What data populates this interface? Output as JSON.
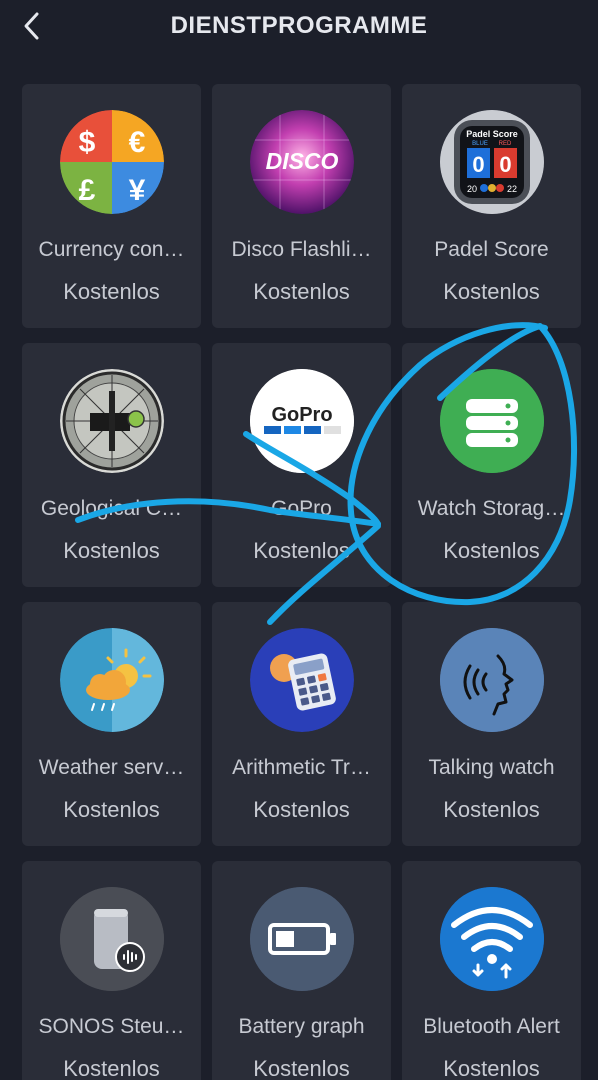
{
  "header": {
    "title": "DIENSTPROGRAMME",
    "back_icon": "chevron-left-icon"
  },
  "apps": [
    {
      "name": "Currency con…",
      "price": "Kostenlos",
      "icon": "currency-icon"
    },
    {
      "name": "Disco Flashli…",
      "price": "Kostenlos",
      "icon": "disco-icon"
    },
    {
      "name": "Padel Score",
      "price": "Kostenlos",
      "icon": "padel-score-icon"
    },
    {
      "name": "Geological C…",
      "price": "Kostenlos",
      "icon": "compass-icon"
    },
    {
      "name": "GoPro",
      "price": "Kostenlos",
      "icon": "gopro-icon"
    },
    {
      "name": "Watch Storag…",
      "price": "Kostenlos",
      "icon": "database-icon"
    },
    {
      "name": "Weather serv…",
      "price": "Kostenlos",
      "icon": "weather-icon"
    },
    {
      "name": "Arithmetic Tr…",
      "price": "Kostenlos",
      "icon": "calculator-icon"
    },
    {
      "name": "Talking watch",
      "price": "Kostenlos",
      "icon": "speaking-head-icon"
    },
    {
      "name": "SONOS Steu…",
      "price": "Kostenlos",
      "icon": "speaker-icon"
    },
    {
      "name": "Battery graph",
      "price": "Kostenlos",
      "icon": "battery-icon"
    },
    {
      "name": "Bluetooth Alert",
      "price": "Kostenlos",
      "icon": "bluetooth-alert-icon"
    }
  ],
  "padel_icon_text": {
    "title": "Padel Score",
    "blue": "BLUE",
    "red": "RED"
  },
  "disco_icon_text": "DISCO",
  "gopro_icon_text": "GoPro",
  "colors": {
    "background": "#1c1f2a",
    "card": "#2a2d38",
    "annotation": "#1aa7e6"
  }
}
